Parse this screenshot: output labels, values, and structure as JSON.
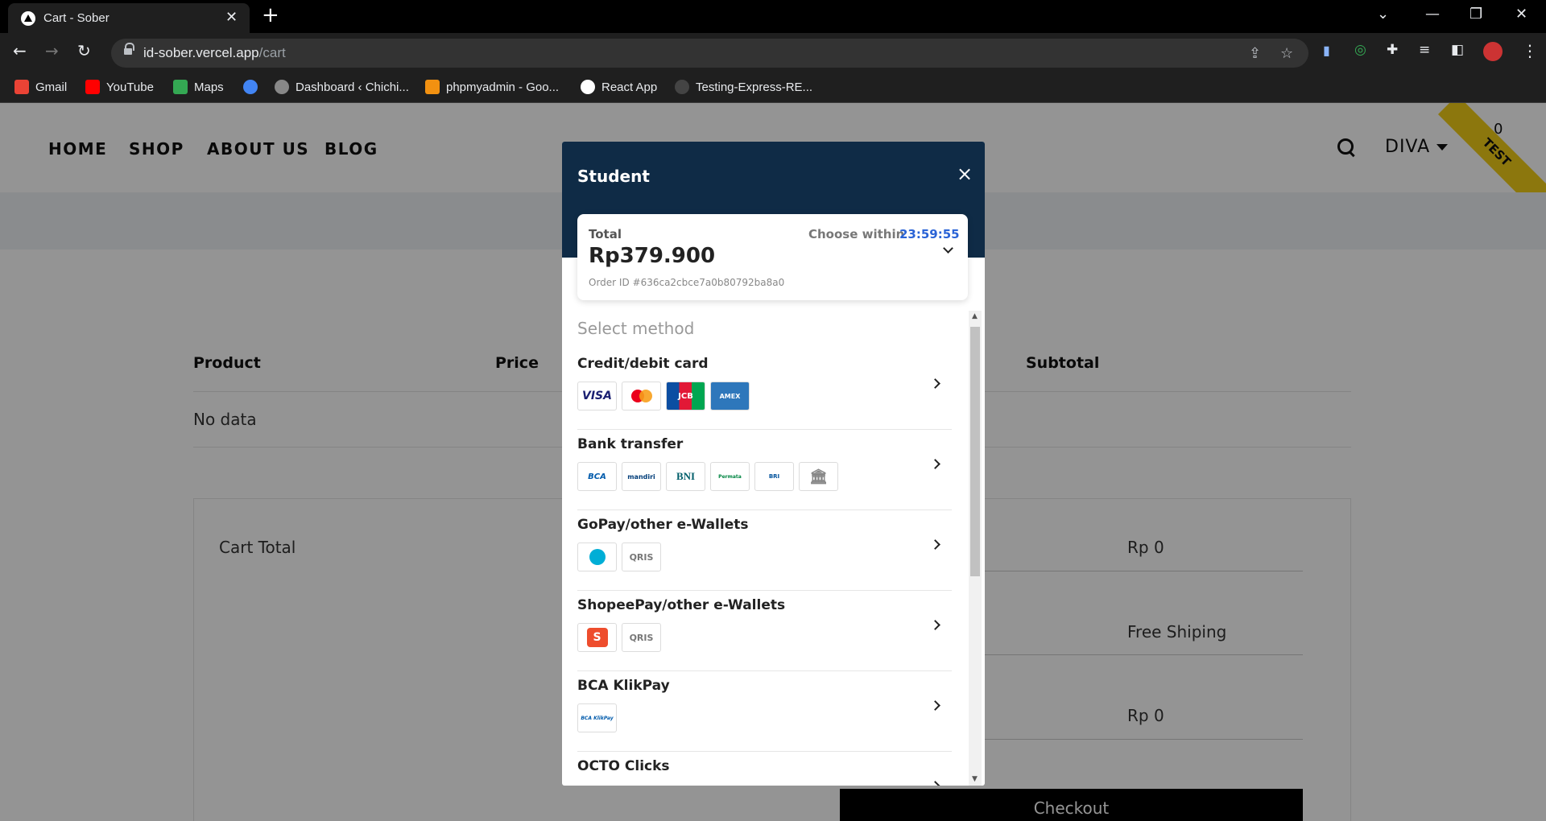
{
  "browser": {
    "tab_title": "Cart - Sober",
    "url_host": "id-sober.vercel.app",
    "url_path": "/cart",
    "bookmarks": [
      {
        "label": "Gmail",
        "color": "#ea4335"
      },
      {
        "label": "YouTube",
        "color": "#ff0000"
      },
      {
        "label": "Maps",
        "color": "#34a853"
      },
      {
        "label": "",
        "color": "#4285f4"
      },
      {
        "label": "Dashboard ‹ Chichi...",
        "color": "#888888"
      },
      {
        "label": "phpmyadmin - Goo...",
        "color": "#f29111"
      },
      {
        "label": "React App",
        "color": "#ffffff"
      },
      {
        "label": "Testing-Express-RE...",
        "color": "#444444"
      }
    ]
  },
  "site": {
    "nav": [
      "HOME",
      "SHOP",
      "ABOUT US",
      "BLOG"
    ],
    "user": "DIVA",
    "cart_count": "0",
    "ribbon": "TEST"
  },
  "cart": {
    "columns": [
      "Product",
      "Price",
      "Subtotal"
    ],
    "empty_text": "No data",
    "total_title": "Cart Total",
    "values": [
      "Rp 0",
      "Free Shiping",
      "Rp 0"
    ],
    "checkout": "Checkout"
  },
  "modal": {
    "title": "Student",
    "close": "×",
    "total_label": "Total",
    "choose_within": "Choose within",
    "timer": "23:59:55",
    "amount": "Rp379.900",
    "order_id": "Order ID #636ca2cbce7a0b80792ba8a0",
    "select_method": "Select method",
    "methods": [
      {
        "name": "Credit/debit card",
        "logos": [
          "VISA",
          "MC",
          "JCB",
          "AMEX"
        ]
      },
      {
        "name": "Bank transfer",
        "logos": [
          "BCA",
          "mandiri",
          "BNI",
          "Permata",
          "BRI",
          "BANK"
        ]
      },
      {
        "name": "GoPay/other e-Wallets",
        "logos": [
          "GoPay",
          "QRIS"
        ]
      },
      {
        "name": "ShopeePay/other e-Wallets",
        "logos": [
          "S",
          "QRIS"
        ]
      },
      {
        "name": "BCA KlikPay",
        "logos": [
          "BCA KlikPay"
        ]
      },
      {
        "name": "OCTO Clicks",
        "logos": []
      }
    ]
  },
  "colors": {
    "modal_header": "#0f2b46",
    "timer": "#2a63d6",
    "ribbon": "#f1cd17"
  }
}
